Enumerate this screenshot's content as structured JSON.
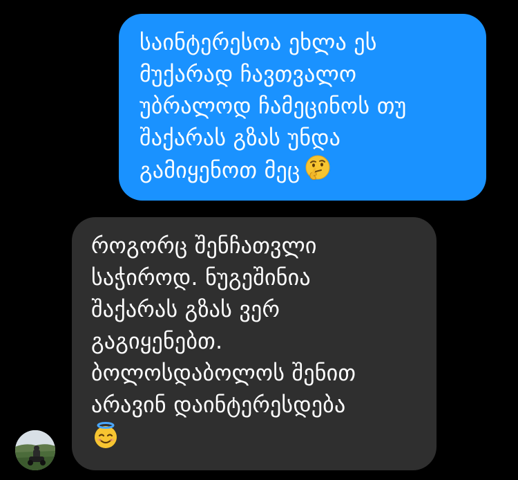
{
  "chat": {
    "outgoing": {
      "lines": [
        "საინტერესოა ეხლა ეს",
        "მუქარად ჩავთვალო",
        "უბრალოდ ჩამეცინოს თუ",
        "შაქარას გზას უნდა",
        "გამიყენოთ მეც"
      ],
      "emoji": "thinking-face-emoji"
    },
    "incoming": {
      "lines": [
        "როგორც შენჩათვლი",
        "საჭიროდ. ნუგეშინია",
        "შაქარას გზას ვერ",
        "გაგიყენებთ.",
        "ბოლოსდაბოლოს შენით",
        "არავინ დაინტერესდება"
      ],
      "emoji": "smiling-face-with-halo-emoji"
    },
    "avatar": "contact-avatar-photo"
  },
  "colors": {
    "background": "#000000",
    "outgoing_bubble": "#1a92ff",
    "incoming_bubble": "#2f2f2f",
    "text": "#ffffff"
  }
}
